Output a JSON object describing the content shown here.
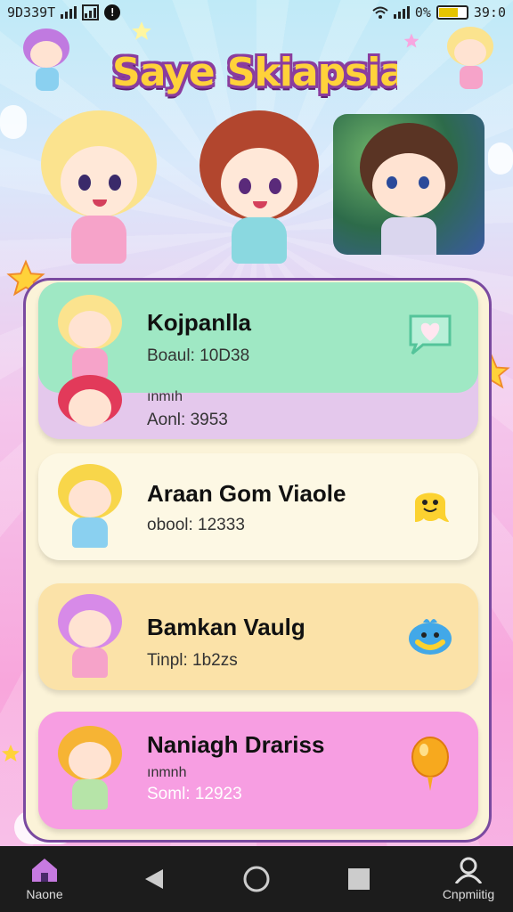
{
  "status": {
    "time": "9D339T",
    "battery_percent": "0%",
    "clock_right": "39:0"
  },
  "header": {
    "title": "Saye Skiapsia!"
  },
  "players": [
    {
      "name": "Kojpanlla",
      "stat": "Boaul: 10D38",
      "extra_label": "ınmıh",
      "extra_stat": "Aonl: 3953",
      "card_color": "#9fe8c4",
      "sub_color": "#e4c8ec",
      "hair": "#fbe38e",
      "badge": "heart-chat-icon"
    },
    {
      "name": "Araan Gom Viaole",
      "stat": "obool: 12333",
      "card_color": "#fdf8e4",
      "hair": "#f8d64a",
      "badge": "smiling-ghost-icon"
    },
    {
      "name": "Bamkan Vaulg",
      "stat": "Tinpl: 1b2zs",
      "card_color": "#fbe2a8",
      "hair": "#d78ae8",
      "badge": "blue-bird-icon"
    },
    {
      "name": "Naniagh Drariss",
      "stat": "Soml: 12923",
      "sub_label": "ınmnh",
      "card_color": "#f79ee2",
      "hair": "#f6b434",
      "badge": "orange-balloon-icon"
    }
  ],
  "nav": {
    "home_label": "Naone",
    "profile_label": "Cnpmiitig"
  },
  "colors": {
    "panel_border": "#7a4aa0",
    "title_fill": "#ffd23a",
    "title_outline": "#8a3d9e",
    "nav_background": "#1c1c1c"
  }
}
